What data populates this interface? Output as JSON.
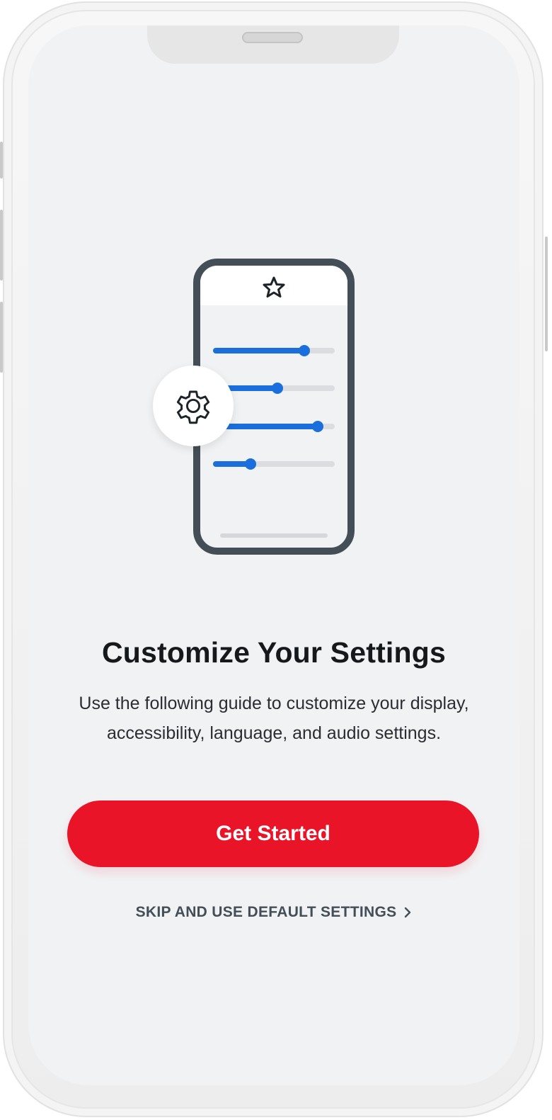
{
  "onboarding": {
    "title": "Customize Your Settings",
    "description": "Use the following guide to customize your display, accessibility, language, and audio settings.",
    "primary_button_label": "Get Started",
    "skip_link_label": "SKIP AND USE DEFAULT SETTINGS"
  },
  "illustration": {
    "logo_icon": "star-outline-icon",
    "settings_icon": "gear-icon",
    "slider_levels": [
      0.75,
      0.53,
      0.86,
      0.31
    ]
  },
  "colors": {
    "accent": "#ea1429",
    "slider": "#1b6fdc",
    "frame_dark": "#434e57",
    "background": "#f1f2f4"
  }
}
